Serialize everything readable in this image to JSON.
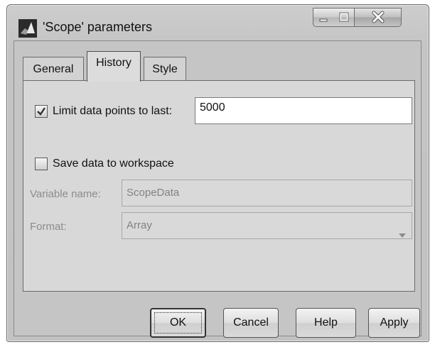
{
  "window": {
    "title": "'Scope' parameters",
    "icon": "matlab-icon",
    "controls": [
      "minimize-icon",
      "maximize-icon",
      "close-icon"
    ]
  },
  "tabs": [
    {
      "label": "General",
      "active": false
    },
    {
      "label": "History",
      "active": true
    },
    {
      "label": "Style",
      "active": false
    }
  ],
  "history": {
    "limit_checkbox": {
      "label": "Limit data points to last:",
      "checked": true
    },
    "limit_value": "5000",
    "save_checkbox": {
      "label": "Save data to workspace",
      "checked": false
    },
    "variable_name": {
      "label": "Variable name:",
      "value": "ScopeData",
      "enabled": false
    },
    "format": {
      "label": "Format:",
      "value": "Array",
      "enabled": false
    }
  },
  "buttons": {
    "ok": "OK",
    "cancel": "Cancel",
    "help": "Help",
    "apply": "Apply"
  }
}
